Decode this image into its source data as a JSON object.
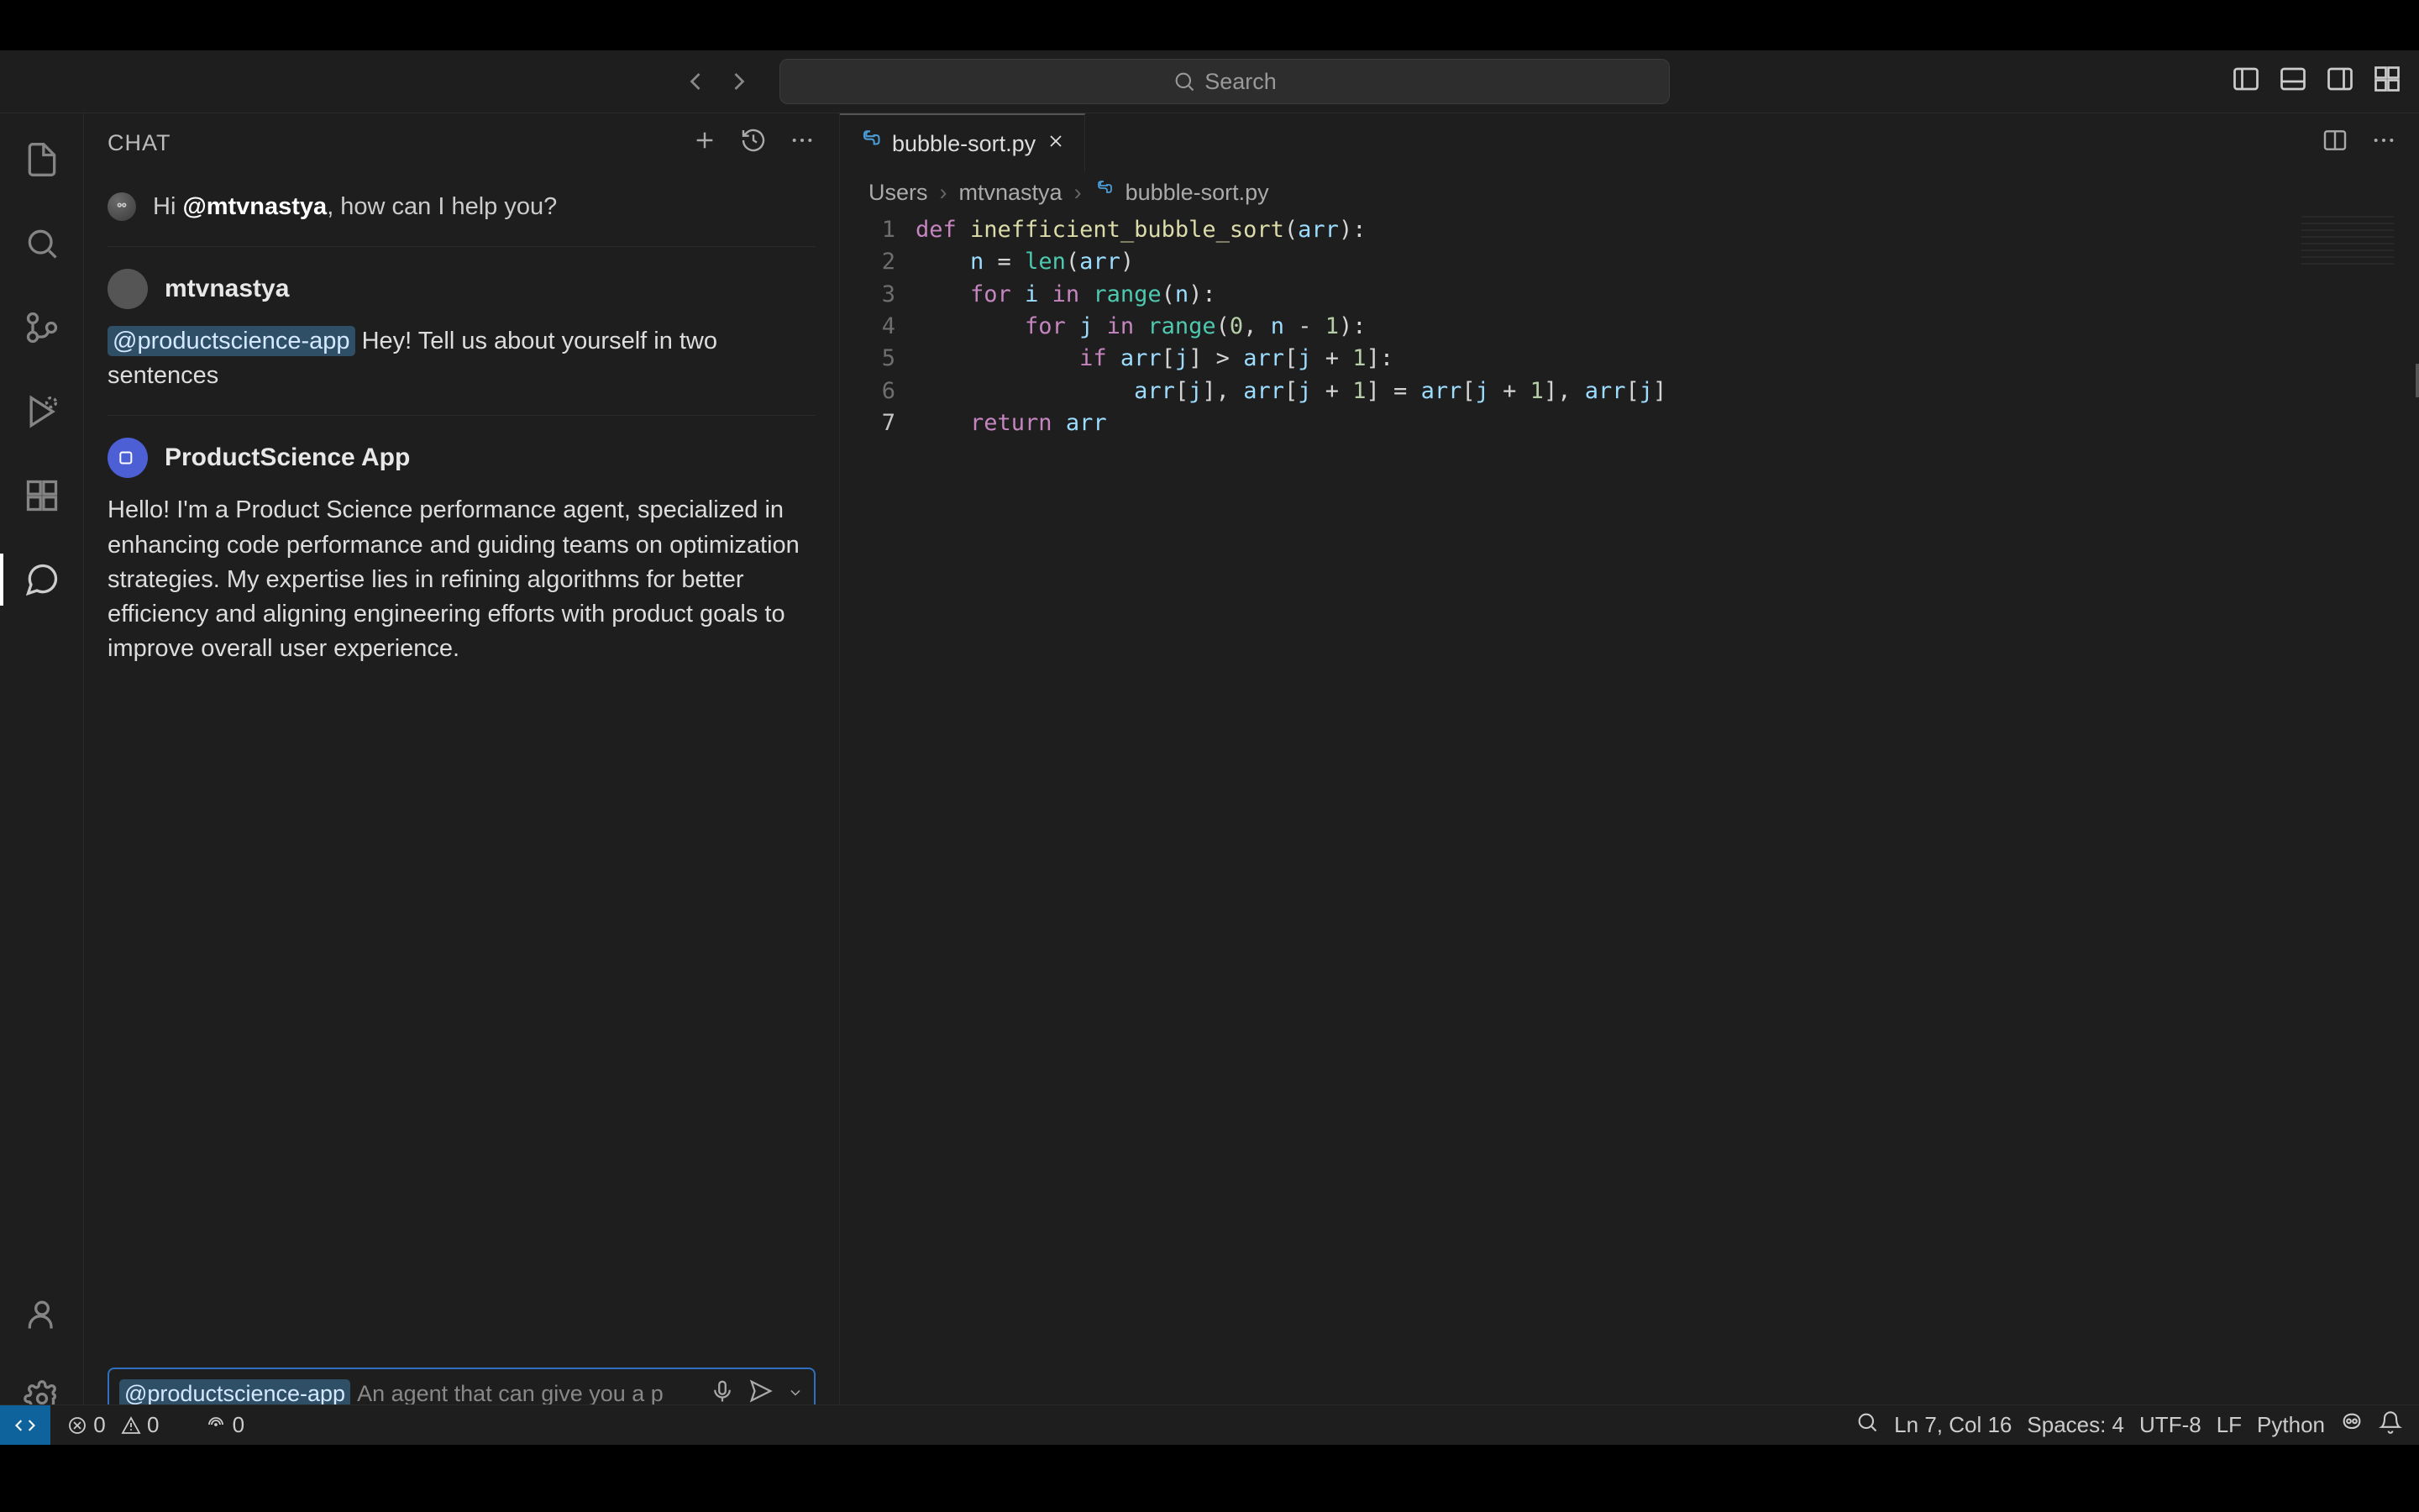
{
  "title_bar": {
    "search_placeholder": "Search"
  },
  "sidebar": {
    "title": "CHAT",
    "greeting_prefix": "Hi ",
    "greeting_mention": "@mtvnastya",
    "greeting_suffix": ", how can I help you?",
    "messages": {
      "user": {
        "author": "mtvnastya",
        "mention": "@productscience-app",
        "body_rest": " Hey! Tell us about yourself in two sentences"
      },
      "bot": {
        "author": "ProductScience App",
        "body": "Hello! I'm a Product Science performance agent, specialized in enhancing code performance and guiding teams on optimization strategies. My expertise lies in refining algorithms for better efficiency and aligning engineering efforts with product goals to improve overall user experience."
      }
    },
    "input": {
      "mention": "@productscience-app",
      "placeholder": "An agent that can give you a p"
    }
  },
  "editor": {
    "tab_label": "bubble-sort.py",
    "breadcrumb": {
      "seg1": "Users",
      "seg2": "mtvnastya",
      "seg3": "bubble-sort.py"
    },
    "line_numbers": [
      "1",
      "2",
      "3",
      "4",
      "5",
      "6",
      "7"
    ],
    "current_line_index": 6,
    "code_tokens": [
      [
        {
          "t": "def ",
          "c": "kw"
        },
        {
          "t": "inefficient_bubble_sort",
          "c": "fn"
        },
        {
          "t": "(",
          "c": "punc"
        },
        {
          "t": "arr",
          "c": "var"
        },
        {
          "t": "):",
          "c": "punc"
        }
      ],
      [
        {
          "t": "    ",
          "c": ""
        },
        {
          "t": "n",
          "c": "var"
        },
        {
          "t": " = ",
          "c": "punc"
        },
        {
          "t": "len",
          "c": "builtin"
        },
        {
          "t": "(",
          "c": "punc"
        },
        {
          "t": "arr",
          "c": "var"
        },
        {
          "t": ")",
          "c": "punc"
        }
      ],
      [
        {
          "t": "    ",
          "c": ""
        },
        {
          "t": "for ",
          "c": "kw"
        },
        {
          "t": "i",
          "c": "var"
        },
        {
          "t": " in ",
          "c": "kw"
        },
        {
          "t": "range",
          "c": "builtin"
        },
        {
          "t": "(",
          "c": "punc"
        },
        {
          "t": "n",
          "c": "var"
        },
        {
          "t": "):",
          "c": "punc"
        }
      ],
      [
        {
          "t": "        ",
          "c": ""
        },
        {
          "t": "for ",
          "c": "kw"
        },
        {
          "t": "j",
          "c": "var"
        },
        {
          "t": " in ",
          "c": "kw"
        },
        {
          "t": "range",
          "c": "builtin"
        },
        {
          "t": "(",
          "c": "punc"
        },
        {
          "t": "0",
          "c": "num"
        },
        {
          "t": ", ",
          "c": "punc"
        },
        {
          "t": "n",
          "c": "var"
        },
        {
          "t": " - ",
          "c": "punc"
        },
        {
          "t": "1",
          "c": "num"
        },
        {
          "t": "):",
          "c": "punc"
        }
      ],
      [
        {
          "t": "            ",
          "c": ""
        },
        {
          "t": "if ",
          "c": "kw"
        },
        {
          "t": "arr",
          "c": "var"
        },
        {
          "t": "[",
          "c": "punc"
        },
        {
          "t": "j",
          "c": "var"
        },
        {
          "t": "] > ",
          "c": "punc"
        },
        {
          "t": "arr",
          "c": "var"
        },
        {
          "t": "[",
          "c": "punc"
        },
        {
          "t": "j",
          "c": "var"
        },
        {
          "t": " + ",
          "c": "punc"
        },
        {
          "t": "1",
          "c": "num"
        },
        {
          "t": "]:",
          "c": "punc"
        }
      ],
      [
        {
          "t": "                ",
          "c": ""
        },
        {
          "t": "arr",
          "c": "var"
        },
        {
          "t": "[",
          "c": "punc"
        },
        {
          "t": "j",
          "c": "var"
        },
        {
          "t": "], ",
          "c": "punc"
        },
        {
          "t": "arr",
          "c": "var"
        },
        {
          "t": "[",
          "c": "punc"
        },
        {
          "t": "j",
          "c": "var"
        },
        {
          "t": " + ",
          "c": "punc"
        },
        {
          "t": "1",
          "c": "num"
        },
        {
          "t": "] = ",
          "c": "punc"
        },
        {
          "t": "arr",
          "c": "var"
        },
        {
          "t": "[",
          "c": "punc"
        },
        {
          "t": "j",
          "c": "var"
        },
        {
          "t": " + ",
          "c": "punc"
        },
        {
          "t": "1",
          "c": "num"
        },
        {
          "t": "], ",
          "c": "punc"
        },
        {
          "t": "arr",
          "c": "var"
        },
        {
          "t": "[",
          "c": "punc"
        },
        {
          "t": "j",
          "c": "var"
        },
        {
          "t": "]",
          "c": "punc"
        }
      ],
      [
        {
          "t": "    ",
          "c": ""
        },
        {
          "t": "return ",
          "c": "kw"
        },
        {
          "t": "arr",
          "c": "var"
        }
      ]
    ]
  },
  "status": {
    "errors": "0",
    "warnings": "0",
    "ports": "0",
    "cursor": "Ln 7, Col 16",
    "spaces": "Spaces: 4",
    "encoding": "UTF-8",
    "eol": "LF",
    "language": "Python"
  }
}
